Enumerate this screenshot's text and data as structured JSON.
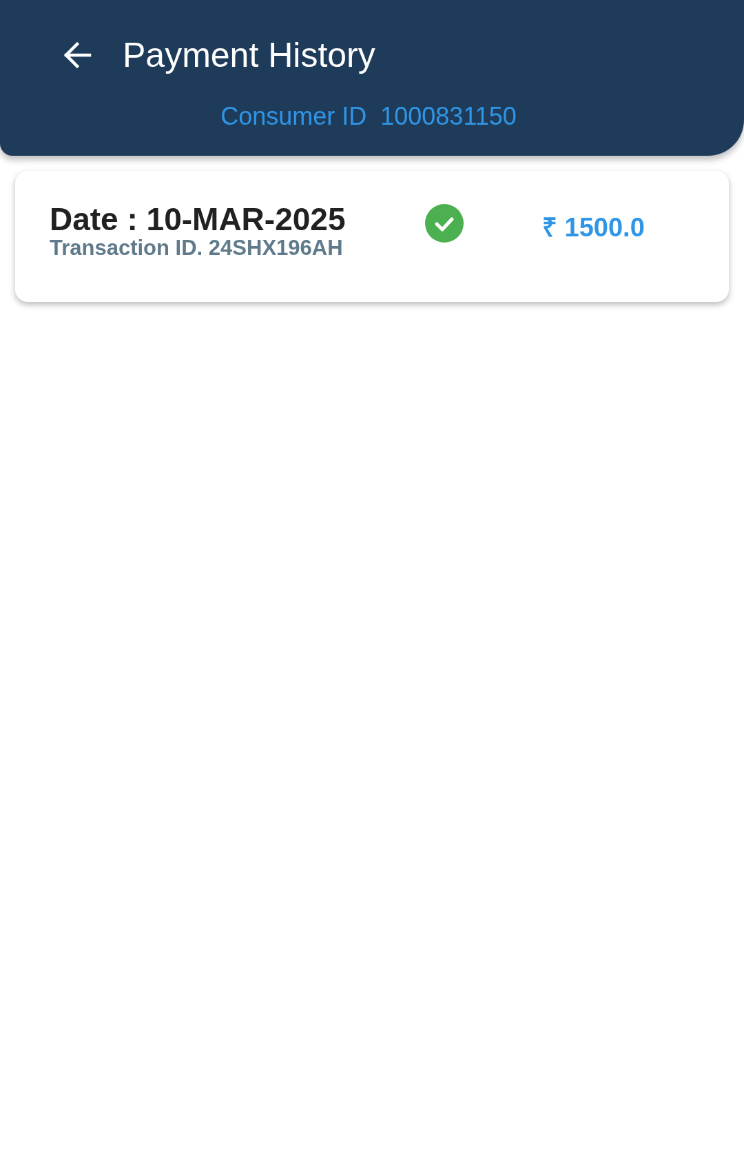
{
  "header": {
    "title": "Payment History",
    "consumer_label": "Consumer ID",
    "consumer_id": "1000831150"
  },
  "payments": [
    {
      "date": "Date : 10-MAR-2025",
      "transaction": "Transaction ID. 24SHX196AH",
      "paid": true,
      "amount": "₹ 1500.0"
    }
  ]
}
